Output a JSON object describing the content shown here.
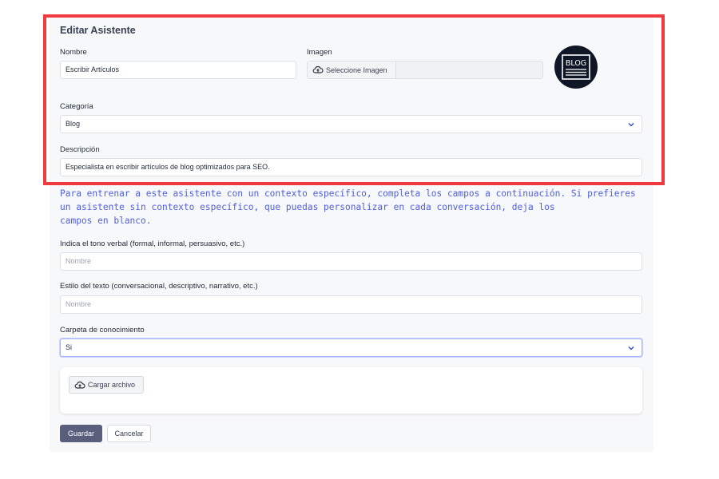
{
  "form": {
    "title": "Editar Asistente",
    "nombre": {
      "label": "Nombre",
      "value": "Escribir Artículos"
    },
    "imagen": {
      "label": "Imagen",
      "button_label": "Seleccione Imagen"
    },
    "logo_text": "BLOG",
    "categoria": {
      "label": "Categoría",
      "value": "Blog"
    },
    "descripcion": {
      "label": "Descripción",
      "value": "Especialista en escribir artículos de blog optimizados para SEO."
    },
    "info_lines": [
      "Para entrenar a este asistente con un contexto específico, completa los campos a continuación. Si prefieres",
      "un asistente sin contexto específico, que puedas personalizar en cada conversación, deja los",
      "campos en blanco."
    ],
    "tono": {
      "label": "Indica el tono verbal (formal, informal, persuasivo, etc.)",
      "placeholder": "Nombre"
    },
    "estilo": {
      "label": "Estilo del texto (conversacional, descriptivo, narrativo, etc.)",
      "placeholder": "Nombre"
    },
    "carpeta": {
      "label": "Carpeta de conocimiento",
      "value": "Si"
    },
    "upload_label": "Cargar archivo",
    "save_label": "Guardar",
    "cancel_label": "Cancelar"
  },
  "colors": {
    "highlight": "#ef3b3f",
    "info_text": "#4f5fe0",
    "save_button": "#5a5e7d",
    "logo_bg": "#0f1726"
  },
  "icons": {
    "upload": "cloud-upload-icon",
    "chevron": "chevron-down-icon"
  }
}
